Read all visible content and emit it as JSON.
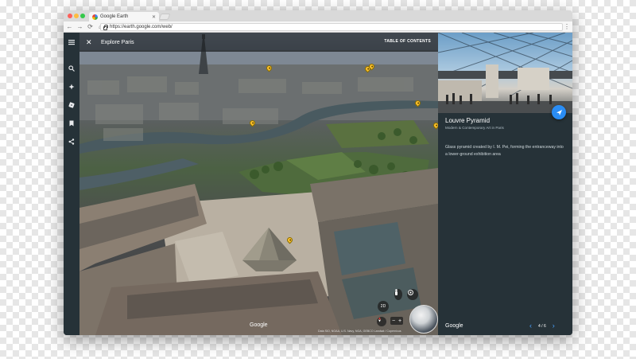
{
  "browser": {
    "tab_title": "Google Earth",
    "url": "https://earth.google.com/web/",
    "nav": {
      "back": "←",
      "forward": "→",
      "reload": "⟳",
      "home": "⌂"
    },
    "menu": "⋮"
  },
  "rail": {
    "icons": [
      "menu-icon",
      "search-icon",
      "voyager-icon",
      "feeling-lucky-icon",
      "my-places-icon",
      "share-icon"
    ]
  },
  "tour": {
    "title": "Explore Paris",
    "close": "✕",
    "toc_label": "TABLE OF CONTENTS"
  },
  "map": {
    "watermark": "Google",
    "attribution": "Data SIO, NOAA, U.S. Navy, NGA, GEBCO  Landsat / Copernicus",
    "controls": {
      "view_mode": "2D",
      "zoom_in": "+",
      "zoom_out": "−"
    }
  },
  "card": {
    "title": "Louvre Pyramid",
    "subtitle": "Modern & Contemporary Art in Paris",
    "description": "Glass pyramid created by I. M. Pei, forming the entranceway into a lower-ground exhibition area",
    "watermark": "Google",
    "pager": {
      "prev": "‹",
      "text": "4 / 6",
      "next": "›"
    }
  },
  "colors": {
    "rail": "#263238",
    "panel": "#263238",
    "fab": "#2a8df5",
    "pin": "#fbc02d",
    "link": "#4aa3ff"
  }
}
